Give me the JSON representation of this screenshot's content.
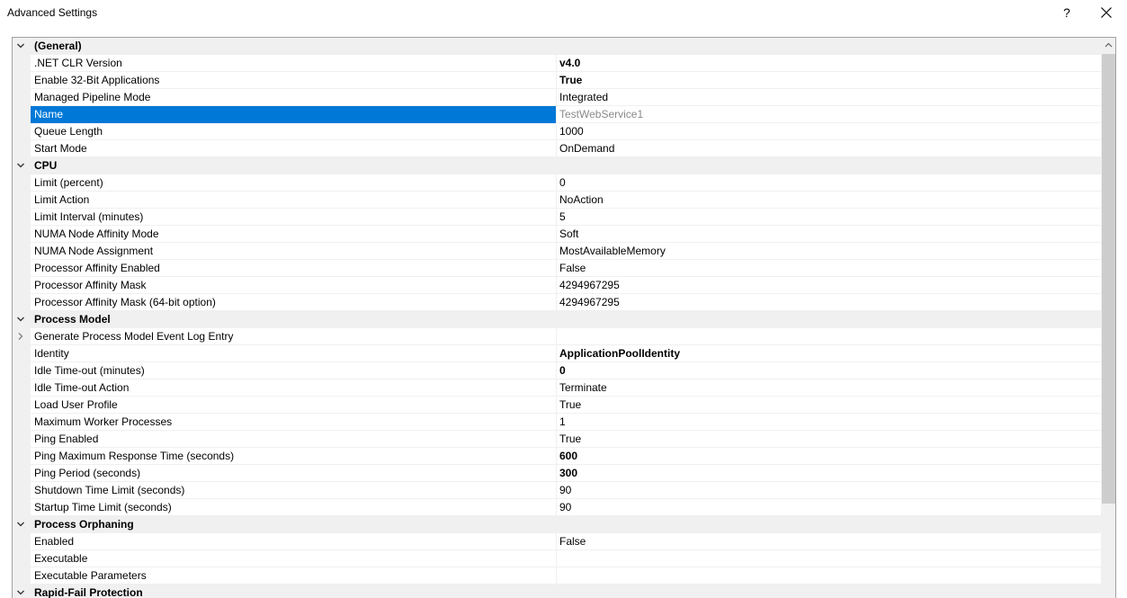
{
  "window": {
    "title": "Advanced Settings",
    "help_label": "?"
  },
  "grid": {
    "rows": [
      {
        "type": "category",
        "name": "(General)",
        "toggle": "expanded"
      },
      {
        "type": "prop",
        "name": ".NET CLR Version",
        "value": "v4.0",
        "bold": true
      },
      {
        "type": "prop",
        "name": "Enable 32-Bit Applications",
        "value": "True",
        "bold": true
      },
      {
        "type": "prop",
        "name": "Managed Pipeline Mode",
        "value": "Integrated"
      },
      {
        "type": "prop",
        "name": "Name",
        "value": "TestWebService1",
        "selected": true,
        "dim": true
      },
      {
        "type": "prop",
        "name": "Queue Length",
        "value": "1000"
      },
      {
        "type": "prop",
        "name": "Start Mode",
        "value": "OnDemand"
      },
      {
        "type": "category",
        "name": "CPU",
        "toggle": "expanded"
      },
      {
        "type": "prop",
        "name": "Limit (percent)",
        "value": "0"
      },
      {
        "type": "prop",
        "name": "Limit Action",
        "value": "NoAction"
      },
      {
        "type": "prop",
        "name": "Limit Interval (minutes)",
        "value": "5"
      },
      {
        "type": "prop",
        "name": "NUMA Node Affinity Mode",
        "value": "Soft"
      },
      {
        "type": "prop",
        "name": "NUMA Node Assignment",
        "value": "MostAvailableMemory"
      },
      {
        "type": "prop",
        "name": "Processor Affinity Enabled",
        "value": "False"
      },
      {
        "type": "prop",
        "name": "Processor Affinity Mask",
        "value": "4294967295"
      },
      {
        "type": "prop",
        "name": "Processor Affinity Mask (64-bit option)",
        "value": "4294967295"
      },
      {
        "type": "category",
        "name": "Process Model",
        "toggle": "expanded"
      },
      {
        "type": "prop",
        "name": "Generate Process Model Event Log Entry",
        "value": "",
        "toggle": "collapsed"
      },
      {
        "type": "prop",
        "name": "Identity",
        "value": "ApplicationPoolIdentity",
        "bold": true
      },
      {
        "type": "prop",
        "name": "Idle Time-out (minutes)",
        "value": "0",
        "bold": true
      },
      {
        "type": "prop",
        "name": "Idle Time-out Action",
        "value": "Terminate"
      },
      {
        "type": "prop",
        "name": "Load User Profile",
        "value": "True"
      },
      {
        "type": "prop",
        "name": "Maximum Worker Processes",
        "value": "1"
      },
      {
        "type": "prop",
        "name": "Ping Enabled",
        "value": "True"
      },
      {
        "type": "prop",
        "name": "Ping Maximum Response Time (seconds)",
        "value": "600",
        "bold": true
      },
      {
        "type": "prop",
        "name": "Ping Period (seconds)",
        "value": "300",
        "bold": true
      },
      {
        "type": "prop",
        "name": "Shutdown Time Limit (seconds)",
        "value": "90"
      },
      {
        "type": "prop",
        "name": "Startup Time Limit (seconds)",
        "value": "90"
      },
      {
        "type": "category",
        "name": "Process Orphaning",
        "toggle": "expanded"
      },
      {
        "type": "prop",
        "name": "Enabled",
        "value": "False"
      },
      {
        "type": "prop",
        "name": "Executable",
        "value": ""
      },
      {
        "type": "prop",
        "name": "Executable Parameters",
        "value": ""
      },
      {
        "type": "category",
        "name": "Rapid-Fail Protection",
        "toggle": "expanded"
      }
    ]
  },
  "colors": {
    "selection": "#0078d7",
    "category_bg": "#f0f0f0",
    "scroll_thumb": "#cdcdcd"
  },
  "icons": {
    "expanded": "chevron-down-icon",
    "collapsed": "chevron-right-icon",
    "close": "close-icon",
    "scroll_up": "chevron-up-icon"
  }
}
